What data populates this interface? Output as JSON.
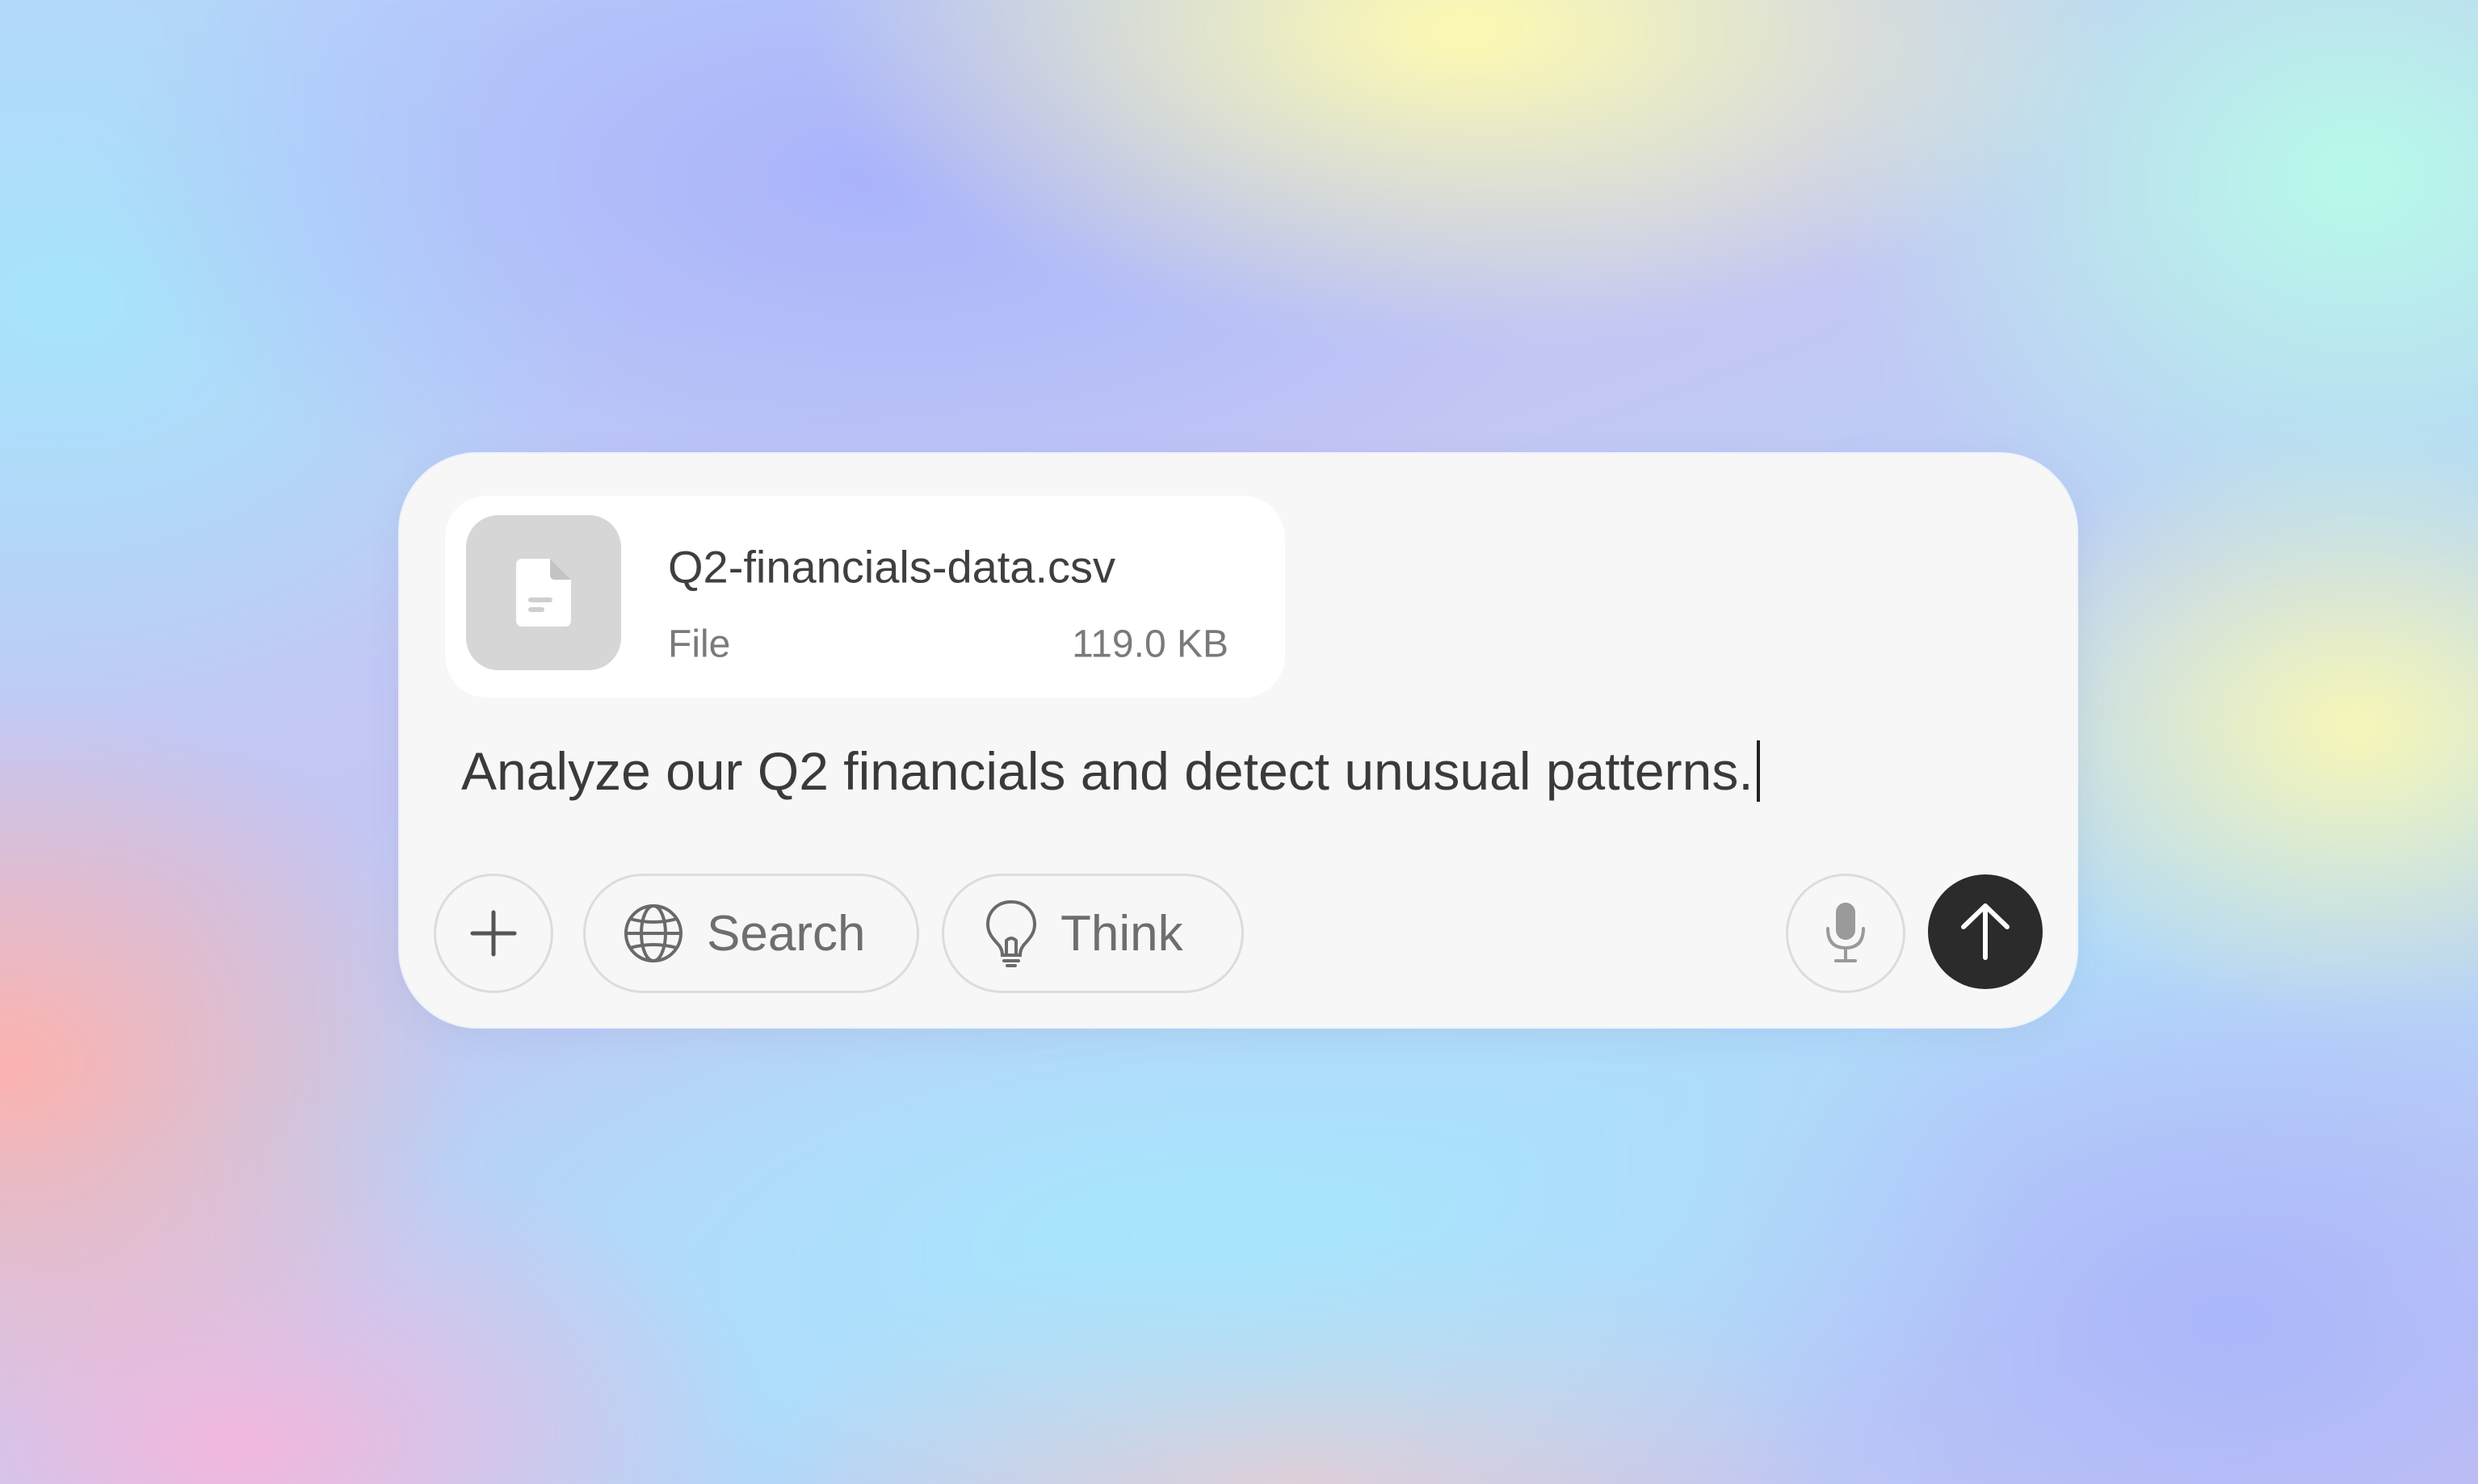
{
  "background": {
    "colors": [
      "#aab3fb",
      "#a6e4fb",
      "#fffbb0",
      "#b7fbe9",
      "#fdb2ad",
      "#f4b6dc"
    ]
  },
  "composer": {
    "attachment": {
      "file_name": "Q2-financials-data.csv",
      "file_type": "File",
      "file_size": "119.0 KB",
      "thumbnail_icon": "document-icon"
    },
    "prompt_text": "Analyze our Q2 financials and detect unusual patterns.",
    "toolbar": {
      "add_icon": "plus-icon",
      "search_label": "Search",
      "search_icon": "globe-icon",
      "think_label": "Think",
      "think_icon": "lightbulb-icon",
      "mic_icon": "microphone-icon",
      "send_icon": "arrow-up-icon"
    },
    "colors": {
      "panel": "#f7f7f7",
      "send_button": "#2b2b2b",
      "muted_text": "#6e6e6e"
    }
  }
}
